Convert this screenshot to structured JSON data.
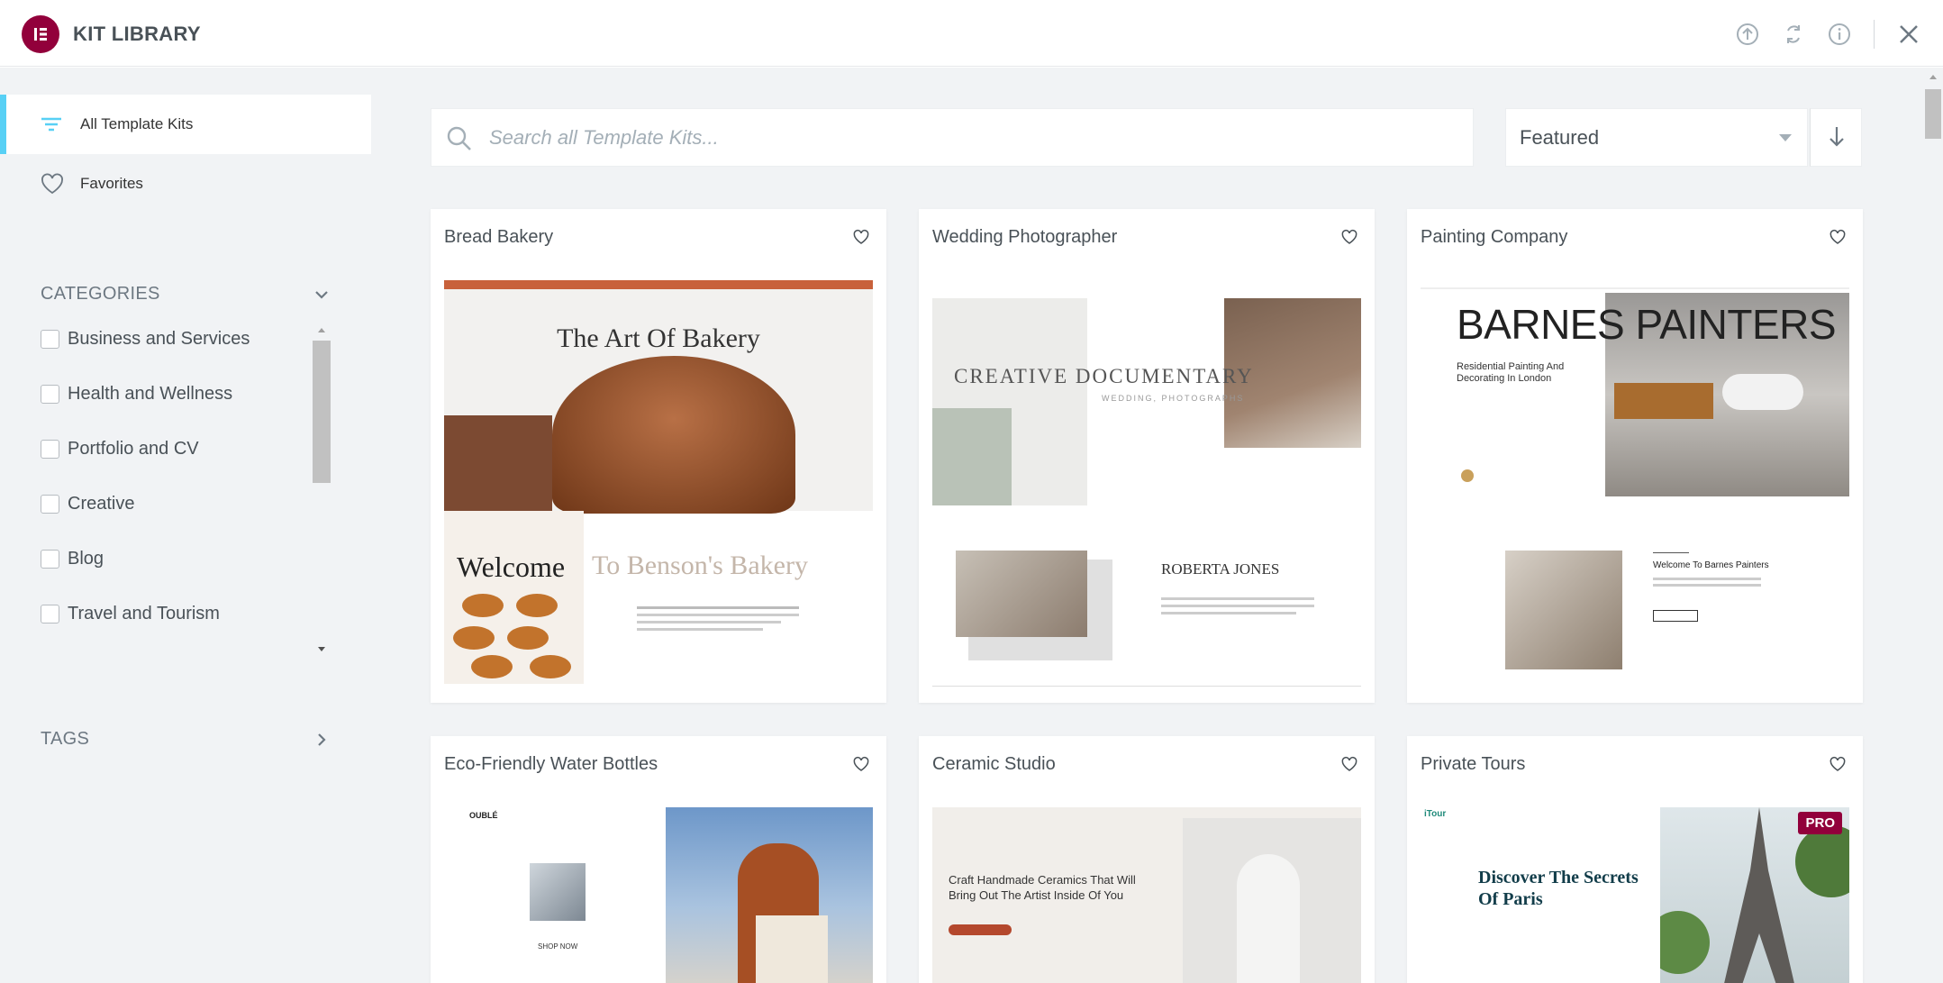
{
  "header": {
    "title": "KIT LIBRARY",
    "logo_letter": "E"
  },
  "toolbar_icons": [
    "upload-icon",
    "sync-icon",
    "info-icon",
    "close-icon"
  ],
  "sidebar": {
    "items": [
      {
        "label": "All Template Kits",
        "icon": "filter-icon"
      },
      {
        "label": "Favorites",
        "icon": "heart-icon"
      }
    ],
    "categories_title": "CATEGORIES",
    "categories": [
      "Business and Services",
      "Health and Wellness",
      "Portfolio and CV",
      "Creative",
      "Blog",
      "Travel and Tourism"
    ],
    "tags_title": "TAGS"
  },
  "search": {
    "placeholder": "Search all Template Kits..."
  },
  "sort": {
    "selected": "Featured"
  },
  "kits": [
    {
      "title": "Bread Bakery",
      "hero": "The Art Of Bakery",
      "sub1": "Welcome",
      "sub2": "To Benson's Bakery"
    },
    {
      "title": "Wedding Photographer",
      "hero": "CREATIVE DOCUMENTARY",
      "sub1": "WEDDING, PHOTOGRAPHS",
      "sub2": "ROBERTA JONES"
    },
    {
      "title": "Painting Company",
      "hero": "BARNES PAINTERS",
      "sub1": "Residential Painting And Decorating In London",
      "sub2": "Welcome To Barnes Painters"
    },
    {
      "title": "Eco-Friendly Water Bottles",
      "hero": "OUBLÉ",
      "sub1": "SHOP NOW",
      "sub2": ""
    },
    {
      "title": "Ceramic Studio",
      "hero": "Craft Handmade Ceramics That Will Bring Out The Artist Inside Of You",
      "sub1": "",
      "sub2": ""
    },
    {
      "title": "Private Tours",
      "hero": "Discover The Secrets Of Paris",
      "sub1": "iTour",
      "sub2": "",
      "badge": "PRO"
    }
  ],
  "colors": {
    "brand": "#92003b",
    "accent": "#58d0f5",
    "bg": "#f1f3f5"
  }
}
